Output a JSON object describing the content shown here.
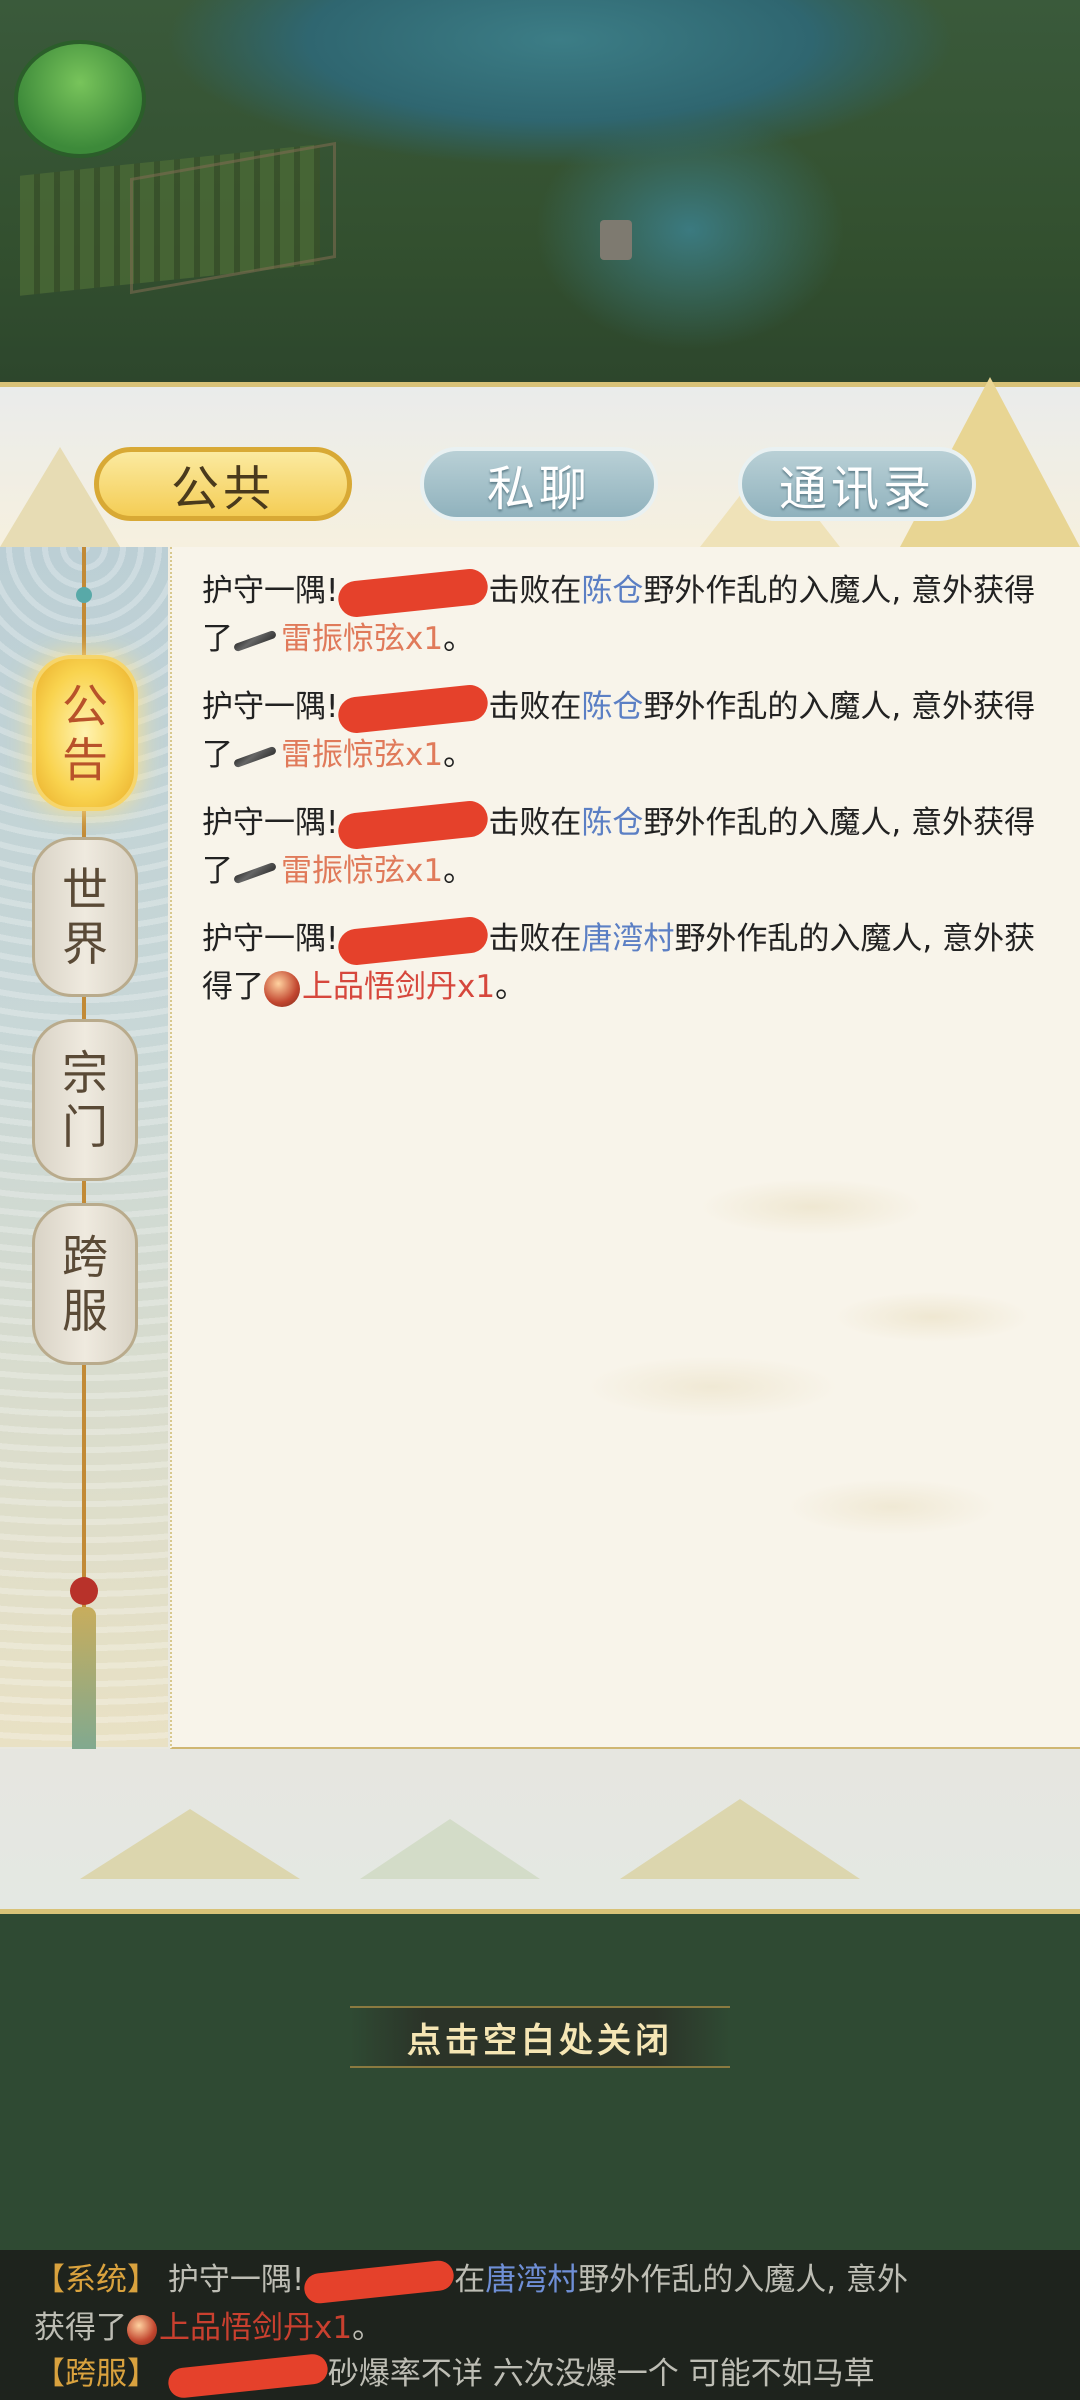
{
  "tabs": {
    "public": "公共",
    "private": "私聊",
    "contacts": "通讯录"
  },
  "sidebar": {
    "announce": [
      "公",
      "告"
    ],
    "world": [
      "世",
      "界"
    ],
    "sect": [
      "宗",
      "门"
    ],
    "cross": [
      "跨",
      "服"
    ]
  },
  "messages": [
    {
      "prefix": "护守一隅!",
      "mid": "击败在",
      "location": "陈仓",
      "suffix": "野外作乱的入魔人, 意外获得了",
      "item": "雷振惊弦x1",
      "end": "。"
    },
    {
      "prefix": "护守一隅!",
      "mid": "击败在",
      "location": "陈仓",
      "suffix": "野外作乱的入魔人, 意外获得了",
      "item": "雷振惊弦x1",
      "end": "。"
    },
    {
      "prefix": "护守一隅!",
      "mid": "击败在",
      "location": "陈仓",
      "suffix": "野外作乱的入魔人, 意外获得了",
      "item": "雷振惊弦x1",
      "end": "。"
    },
    {
      "prefix": "护守一隅!",
      "mid": "击败在",
      "location": "唐湾村",
      "suffix": "野外作乱的入魔人, 意外获得了",
      "item": "上品悟剑丹x1",
      "end": "。"
    }
  ],
  "close_hint": "点击空白处关闭",
  "chat": {
    "line1": {
      "channel": "【系统】",
      "prefix": "护守一隅!",
      "mid": "在",
      "location": "唐湾村",
      "suffix": "野外作乱的入魔人, 意外",
      "cont": "获得了",
      "item": "上品悟剑丹x1",
      "end": "。"
    },
    "line2": {
      "channel": "【跨服】",
      "text": "砂爆率不详 六次没爆一个 可能不如马草"
    }
  },
  "colors": {
    "location": "#5b7fc4",
    "item": "#e07a5a",
    "redaction": "#e5412b",
    "active_tab": "#f4cd55"
  }
}
